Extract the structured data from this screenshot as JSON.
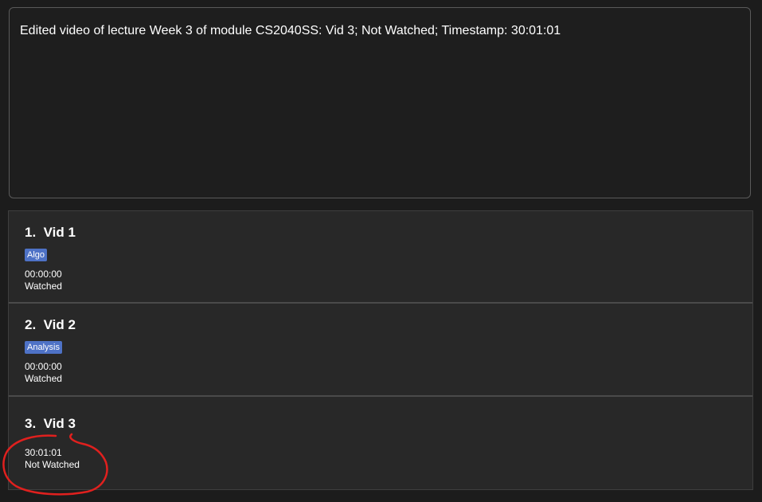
{
  "result": {
    "text": "Edited video of lecture Week 3 of module CS2040SS: Vid 3; Not Watched; Timestamp: 30:01:01"
  },
  "videos": [
    {
      "title": "1.  Vid 1",
      "tag": "Algo",
      "timestamp": "00:00:00",
      "status": "Watched"
    },
    {
      "title": "2.  Vid 2",
      "tag": "Analysis",
      "timestamp": "00:00:00",
      "status": "Watched"
    },
    {
      "title": "3.  Vid 3",
      "timestamp": "30:01:01",
      "status": "Not Watched"
    }
  ],
  "colors": {
    "background": "#1c1c1c",
    "card": "#282828",
    "tag": "#4e72c6",
    "annotation": "#e0201e"
  }
}
